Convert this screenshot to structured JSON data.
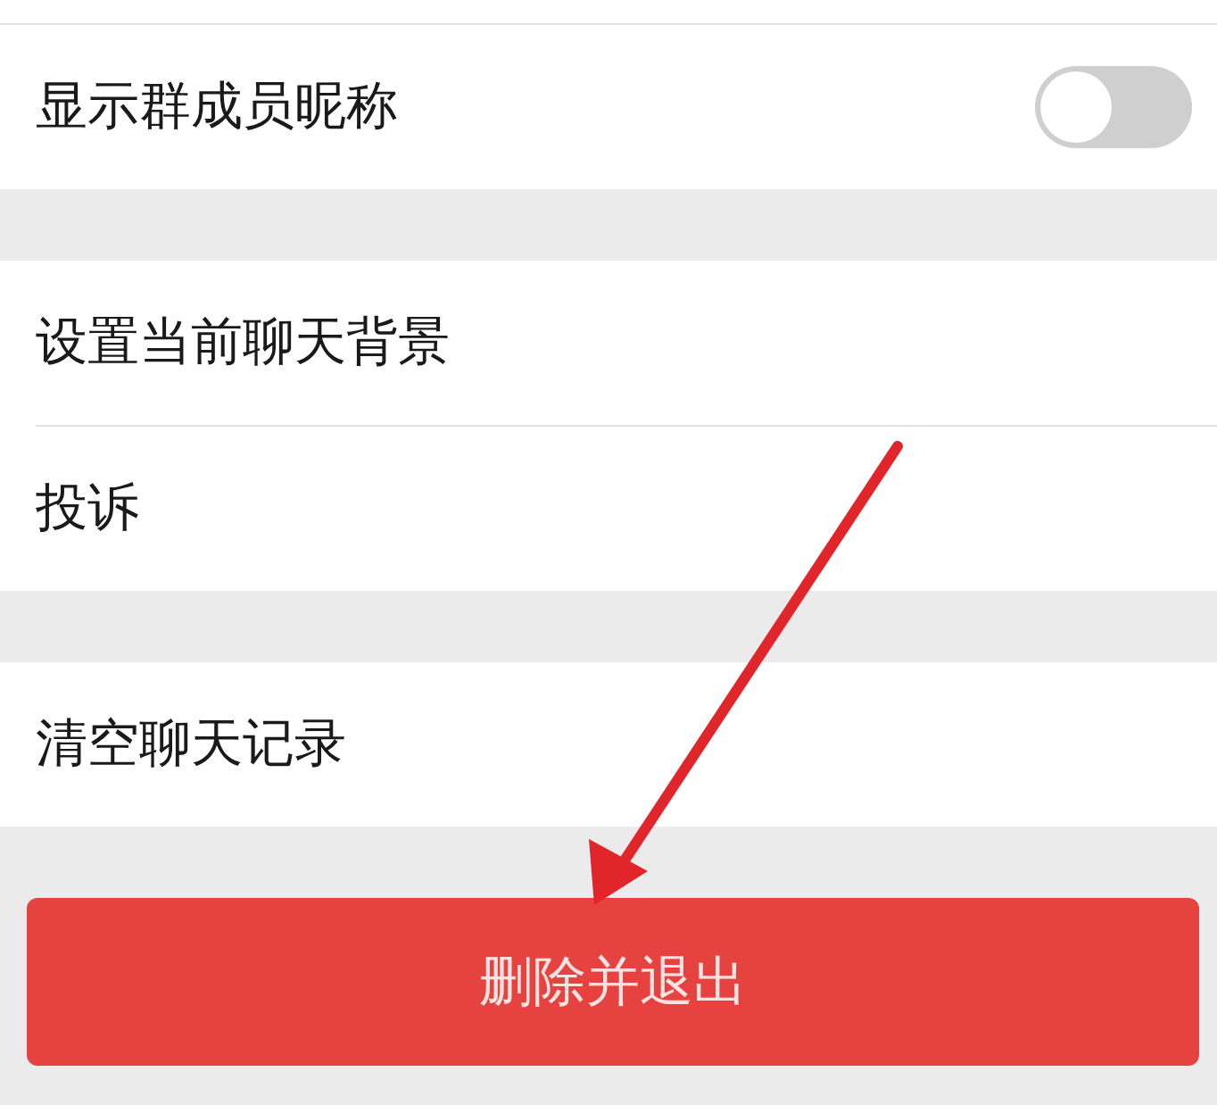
{
  "sections": [
    {
      "rows": [
        {
          "label": "显示群成员昵称",
          "kind": "toggle",
          "on": false
        }
      ]
    },
    {
      "rows": [
        {
          "label": "设置当前聊天背景",
          "kind": "link"
        },
        {
          "label": "投诉",
          "kind": "link"
        }
      ]
    },
    {
      "rows": [
        {
          "label": "清空聊天记录",
          "kind": "link"
        }
      ]
    }
  ],
  "button": {
    "label": "删除并退出"
  },
  "annotations": [
    {
      "kind": "arrow"
    }
  ]
}
